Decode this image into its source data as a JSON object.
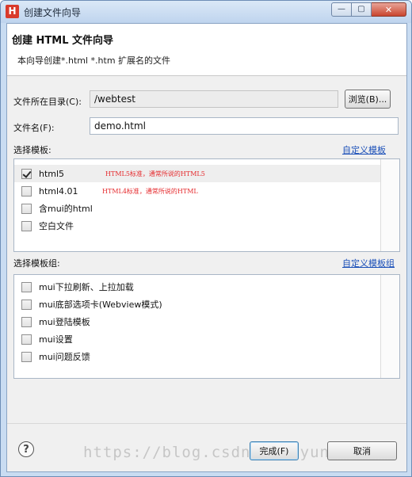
{
  "window": {
    "title": "创建文件向导",
    "app_logo": "H",
    "minimize_glyph": "—",
    "maximize_glyph": "▢",
    "close_glyph": "✕"
  },
  "header": {
    "title": "创建 HTML 文件向导",
    "description": "本向导创建*.html *.htm 扩展名的文件"
  },
  "form": {
    "directory_label": "文件所在目录(C):",
    "directory_value": "/webtest",
    "browse_label": "浏览(B)...",
    "filename_label": "文件名(F):",
    "filename_value": "demo.html"
  },
  "templates": {
    "label": "选择模板:",
    "custom_link": "自定义模板",
    "items": [
      {
        "label": "html5",
        "desc": "HTML5标准，通常所说的HTML5",
        "checked": true
      },
      {
        "label": "html4.01",
        "desc": "HTML4标准，通常所说的HTML",
        "checked": false
      },
      {
        "label": "含mui的html",
        "desc": "",
        "checked": false
      },
      {
        "label": "空白文件",
        "desc": "",
        "checked": false
      }
    ]
  },
  "template_groups": {
    "label": "选择模板组:",
    "custom_link": "自定义模板组",
    "items": [
      {
        "label": "mui下拉刷新、上拉加载",
        "checked": false
      },
      {
        "label": "mui底部选项卡(Webview模式)",
        "checked": false
      },
      {
        "label": "mui登陆模板",
        "checked": false
      },
      {
        "label": "mui设置",
        "checked": false
      },
      {
        "label": "mui问题反馈",
        "checked": false
      }
    ]
  },
  "footer": {
    "help_glyph": "?",
    "finish_label": "完成(F)",
    "cancel_label": "取消"
  },
  "watermark": "https://blog.csdn.net/yunpuj70"
}
